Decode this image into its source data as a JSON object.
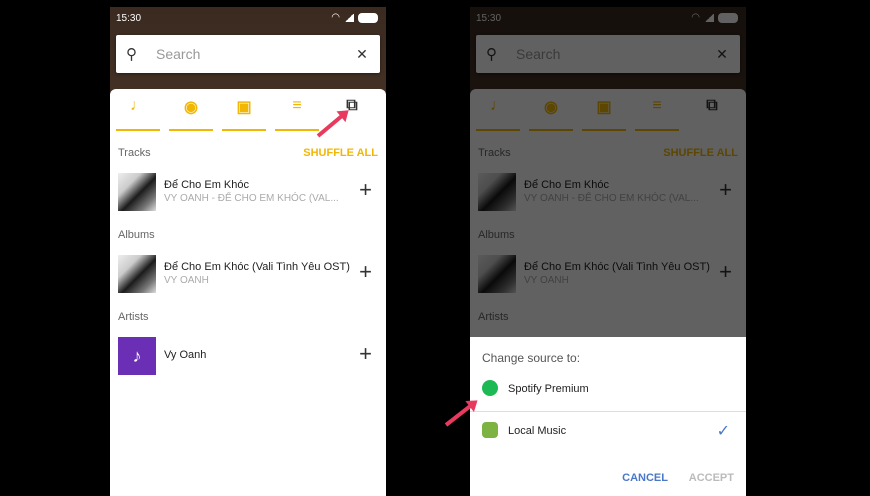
{
  "status": {
    "time": "15:30"
  },
  "search": {
    "placeholder": "Search"
  },
  "tabs": [
    {
      "icon": "music-note-icon",
      "glyph": "♩"
    },
    {
      "icon": "album-disc-icon",
      "glyph": "◉"
    },
    {
      "icon": "artist-card-icon",
      "glyph": "▣"
    },
    {
      "icon": "playlist-icon",
      "glyph": "≡"
    },
    {
      "icon": "source-switch-icon",
      "glyph": "⧉"
    }
  ],
  "sections": {
    "tracks": "Tracks",
    "shuffle": "SHUFFLE ALL",
    "albums": "Albums",
    "artists": "Artists"
  },
  "track": {
    "title": "Để Cho Em Khóc",
    "sub": "VY OANH - ĐỂ CHO EM KHÓC (VAL..."
  },
  "album": {
    "title": "Để Cho Em Khóc (Vali Tình Yêu OST)",
    "sub": "VY OANH"
  },
  "artist": {
    "title": "Vy Oanh"
  },
  "dialog": {
    "heading": "Change source to:",
    "options": [
      {
        "label": "Spotify Premium",
        "color": "#1db954"
      },
      {
        "label": "Local Music",
        "color": "#7cb342",
        "selected": true
      }
    ],
    "cancel": "CANCEL",
    "accept": "ACCEPT"
  },
  "colors": {
    "accent": "#f2b705",
    "arrow": "#e83a5e",
    "check": "#4a78c8"
  }
}
